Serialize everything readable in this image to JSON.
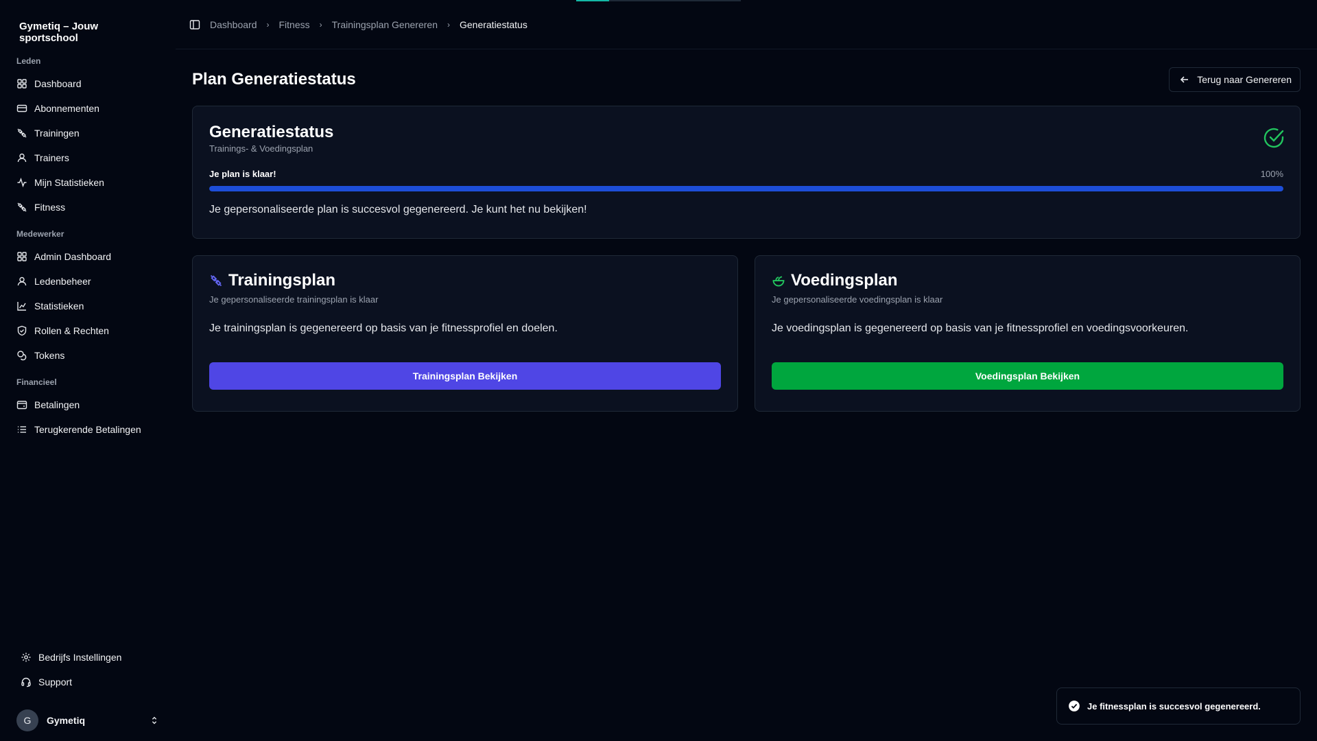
{
  "brand": "Gymetiq – Jouw sportschool",
  "sidebar": {
    "groups": [
      {
        "label": "Leden",
        "items": [
          {
            "label": "Dashboard",
            "icon": "grid-icon"
          },
          {
            "label": "Abonnementen",
            "icon": "card-icon"
          },
          {
            "label": "Trainingen",
            "icon": "dumbbell-icon"
          },
          {
            "label": "Trainers",
            "icon": "user-icon"
          },
          {
            "label": "Mijn Statistieken",
            "icon": "activity-icon"
          },
          {
            "label": "Fitness",
            "icon": "dumbbell-icon"
          }
        ]
      },
      {
        "label": "Medewerker",
        "items": [
          {
            "label": "Admin Dashboard",
            "icon": "grid-icon"
          },
          {
            "label": "Ledenbeheer",
            "icon": "user-icon"
          },
          {
            "label": "Statistieken",
            "icon": "chart-icon"
          },
          {
            "label": "Rollen & Rechten",
            "icon": "shield-icon"
          },
          {
            "label": "Tokens",
            "icon": "coins-icon"
          }
        ]
      },
      {
        "label": "Financieel",
        "items": [
          {
            "label": "Betalingen",
            "icon": "wallet-icon"
          },
          {
            "label": "Terugkerende Betalingen",
            "icon": "list-icon"
          }
        ]
      }
    ],
    "bottom": {
      "settings": "Bedrijfs Instellingen",
      "support": "Support",
      "user_initial": "G",
      "user_name": "Gymetiq"
    }
  },
  "breadcrumb": {
    "items": [
      "Dashboard",
      "Fitness",
      "Trainingsplan Genereren"
    ],
    "current": "Generatiestatus"
  },
  "page": {
    "title": "Plan Generatiestatus",
    "back_label": "Terug naar Genereren"
  },
  "status": {
    "title": "Generatiestatus",
    "subtitle": "Trainings- & Voedingsplan",
    "progress_label": "Je plan is klaar!",
    "progress_text": "100%",
    "progress_value": 100,
    "message": "Je gepersonaliseerde plan is succesvol gegenereerd. Je kunt het nu bekijken!"
  },
  "training": {
    "title": "Trainingsplan",
    "subtitle": "Je gepersonaliseerde trainingsplan is klaar",
    "description": "Je trainingsplan is gegenereerd op basis van je fitnessprofiel en doelen.",
    "button": "Trainingsplan Bekijken",
    "color": "#4f46e5"
  },
  "nutrition": {
    "title": "Voedingsplan",
    "subtitle": "Je gepersonaliseerde voedingsplan is klaar",
    "description": "Je voedingsplan is gegenereerd op basis van je fitnessprofiel en voedingsvoorkeuren.",
    "button": "Voedingsplan Bekijken",
    "color": "#00a63e"
  },
  "toast": {
    "message": "Je fitnessplan is succesvol gegenereerd."
  }
}
